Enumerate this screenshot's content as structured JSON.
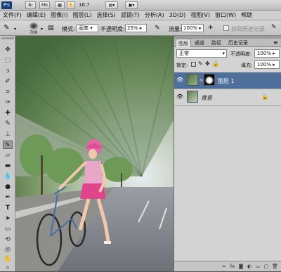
{
  "app": {
    "logo": "Ps",
    "buttons": [
      "Br",
      "Mb"
    ],
    "zoom": "16.7"
  },
  "menu": [
    "文件(F)",
    "编辑(E)",
    "图像(I)",
    "图层(L)",
    "选择(S)",
    "滤镜(T)",
    "分析(A)",
    "3D(D)",
    "视图(V)",
    "窗口(W)",
    "帮助"
  ],
  "options": {
    "brush_size": "700",
    "mode_label": "模式:",
    "mode_value": "画笔",
    "opacity_label": "不透明度:",
    "opacity_value": "25%",
    "flow_label": "流量:",
    "flow_value": "100%",
    "history_label": "抹到历史记录"
  },
  "layers_panel": {
    "tabs": [
      "图层",
      "通道",
      "路径",
      "历史记录"
    ],
    "blend_mode": "正常",
    "opacity_label": "不透明度:",
    "opacity_value": "100%",
    "lock_label": "锁定:",
    "fill_label": "填充:",
    "fill_value": "100%",
    "layers": [
      {
        "name": "图层 1",
        "selected": true
      },
      {
        "name": "背景",
        "selected": false,
        "locked": true
      }
    ]
  }
}
